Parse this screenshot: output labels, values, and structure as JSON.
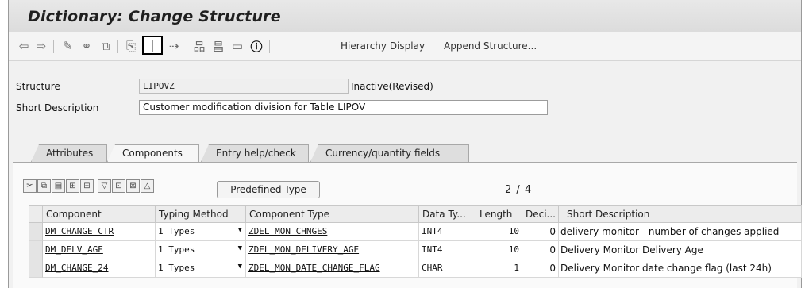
{
  "window": {
    "title": "Dictionary: Change Structure"
  },
  "toolbar": {
    "icons": [
      "back-arrow-icon",
      "forward-arrow-icon",
      "display-change-icon",
      "other-object-icon",
      "activate-icon",
      "where-used-icon",
      "object-list-icon",
      "navigation-icon",
      "graphic-icon",
      "tech-settings-icon",
      "info-icon"
    ],
    "hierarchy_display": "Hierarchy Display",
    "append_structure": "Append Structure..."
  },
  "header": {
    "structure_label": "Structure",
    "structure_value": "LIPOVZ",
    "status": "Inactive(Revised)",
    "short_desc_label": "Short Description",
    "short_desc_value": "Customer modification division for Table LIPOV"
  },
  "tabs": [
    "Attributes",
    "Components",
    "Entry help/check",
    "Currency/quantity fields"
  ],
  "active_tab": "Components",
  "table_toolbar": {
    "predefined_type": "Predefined Type",
    "pager": "2 / 4"
  },
  "table": {
    "columns": [
      "Component",
      "Typing Method",
      "Component Type",
      "Data Ty...",
      "Length",
      "Deci...",
      "Short Description"
    ],
    "rows": [
      {
        "component": "DM_CHANGE_CTR",
        "typing": "1 Types",
        "ctype": "ZDEL_MON_CHNGES",
        "dtype": "INT4",
        "length": "10",
        "dec": "0",
        "desc": "delivery monitor - number of changes applied"
      },
      {
        "component": "DM_DELV_AGE",
        "typing": "1 Types",
        "ctype": "ZDEL_MON_DELIVERY_AGE",
        "dtype": "INT4",
        "length": "10",
        "dec": "0",
        "desc": "Delivery Monitor Delivery Age"
      },
      {
        "component": "DM_CHANGE_24",
        "typing": "1 Types",
        "ctype": "ZDEL_MON_DATE_CHANGE_FLAG",
        "dtype": "CHAR",
        "length": "1",
        "dec": "0",
        "desc": "Delivery Monitor date change flag (last 24h)"
      }
    ]
  }
}
